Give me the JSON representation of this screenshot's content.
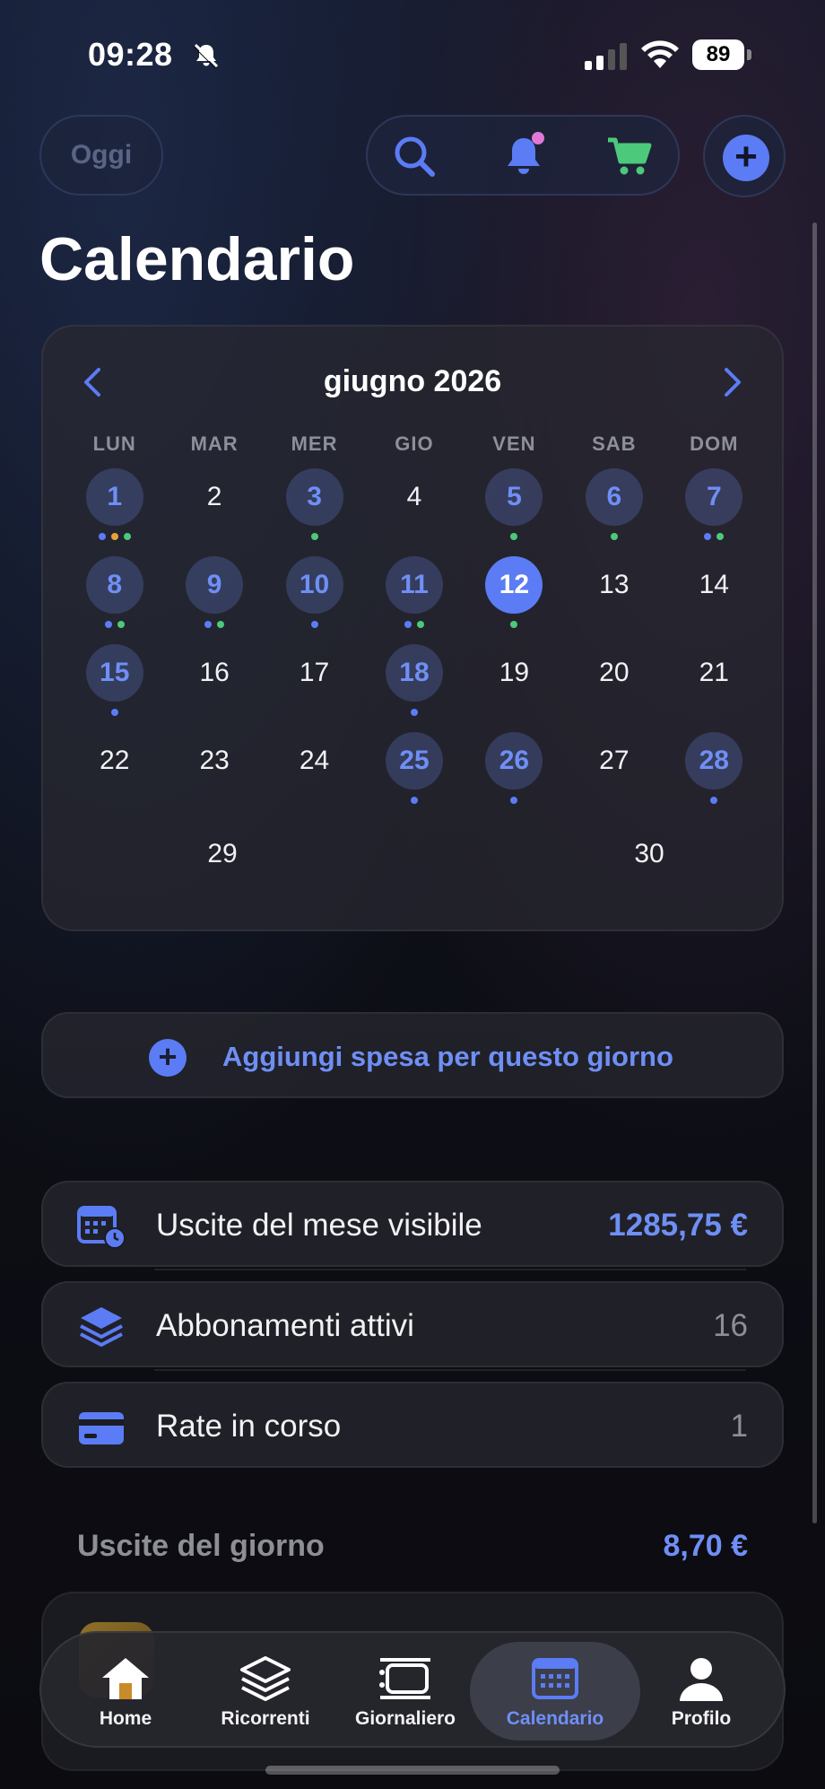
{
  "status": {
    "time": "09:28",
    "battery": "89"
  },
  "header": {
    "today_label": "Oggi",
    "title": "Calendario"
  },
  "calendar": {
    "month_label": "giugno 2026",
    "weekdays": [
      "LUN",
      "MAR",
      "MER",
      "GIO",
      "VEN",
      "SAB",
      "DOM"
    ],
    "days": [
      {
        "n": "1",
        "has": true,
        "dots": [
          "b",
          "o",
          "g"
        ]
      },
      {
        "n": "2"
      },
      {
        "n": "3",
        "has": true,
        "dots": [
          "g"
        ]
      },
      {
        "n": "4"
      },
      {
        "n": "5",
        "has": true,
        "dots": [
          "g"
        ]
      },
      {
        "n": "6",
        "has": true,
        "dots": [
          "g"
        ]
      },
      {
        "n": "7",
        "has": true,
        "dots": [
          "b",
          "g"
        ]
      },
      {
        "n": "8",
        "has": true,
        "dots": [
          "b",
          "g"
        ]
      },
      {
        "n": "9",
        "has": true,
        "dots": [
          "b",
          "g"
        ]
      },
      {
        "n": "10",
        "has": true,
        "dots": [
          "b"
        ]
      },
      {
        "n": "11",
        "has": true,
        "dots": [
          "b",
          "g"
        ]
      },
      {
        "n": "12",
        "sel": true,
        "dots": [
          "g"
        ]
      },
      {
        "n": "13"
      },
      {
        "n": "14"
      },
      {
        "n": "15",
        "has": true,
        "dots": [
          "b"
        ]
      },
      {
        "n": "16"
      },
      {
        "n": "17"
      },
      {
        "n": "18",
        "has": true,
        "dots": [
          "b"
        ]
      },
      {
        "n": "19"
      },
      {
        "n": "20"
      },
      {
        "n": "21"
      },
      {
        "n": "22"
      },
      {
        "n": "23"
      },
      {
        "n": "24"
      },
      {
        "n": "25",
        "has": true,
        "dots": [
          "b"
        ]
      },
      {
        "n": "26",
        "has": true,
        "dots": [
          "b"
        ]
      },
      {
        "n": "27"
      },
      {
        "n": "28",
        "has": true,
        "dots": [
          "b"
        ]
      }
    ],
    "last_row": [
      "29",
      "30"
    ]
  },
  "add_expense_label": "Aggiungi spesa per questo giorno",
  "stats": [
    {
      "label": "Uscite del mese visibile",
      "value": "1285,75 €",
      "icon": "calendar-clock-icon"
    },
    {
      "label": "Abbonamenti attivi",
      "value": "16",
      "icon": "layers-icon"
    },
    {
      "label": "Rate in corso",
      "value": "1",
      "icon": "credit-card-icon"
    }
  ],
  "day_section": {
    "label": "Uscite del giorno",
    "total": "8,70 €"
  },
  "tabs": [
    {
      "label": "Home",
      "icon": "home-icon"
    },
    {
      "label": "Ricorrenti",
      "icon": "layers-icon"
    },
    {
      "label": "Giornaliero",
      "icon": "list-icon"
    },
    {
      "label": "Calendario",
      "icon": "calendar-icon",
      "active": true
    },
    {
      "label": "Profilo",
      "icon": "person-icon"
    }
  ],
  "colors": {
    "accent": "#5b7cf4",
    "accent_text": "#6f8ff5",
    "green": "#4cc97a",
    "notification": "#e078d8"
  }
}
